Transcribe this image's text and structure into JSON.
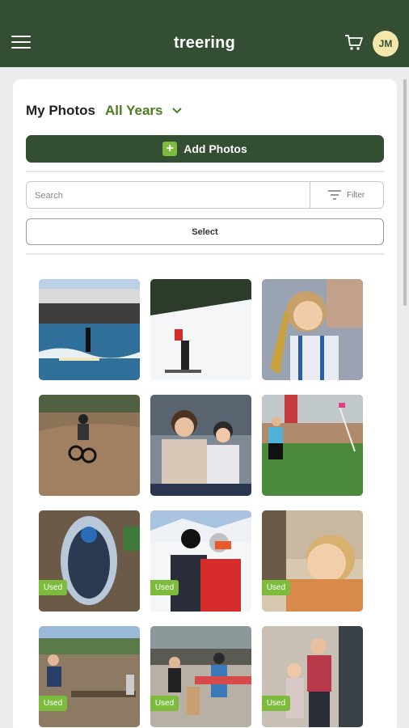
{
  "app": {
    "brand": "treering",
    "avatar_initials": "JM"
  },
  "header": {
    "title": "My Photos",
    "year_filter": "All Years"
  },
  "actions": {
    "add_photos_label": "Add Photos",
    "select_label": "Select"
  },
  "search": {
    "placeholder": "Search",
    "filter_label": "Filter"
  },
  "badge": {
    "used_label": "Used"
  },
  "colors": {
    "appbar": "#344e33",
    "accent_green": "#7dbb3d",
    "year_text": "#4c7d22"
  },
  "icons": [
    "hamburger-menu-icon",
    "cart-icon",
    "chevron-down-icon",
    "plus-icon",
    "filter-icon"
  ],
  "photos": [
    {
      "subject": "surfer at pier",
      "used": false
    },
    {
      "subject": "snowboarder on slope",
      "used": false
    },
    {
      "subject": "boy playing saxophone",
      "used": false
    },
    {
      "subject": "bike rider on dirt track",
      "used": false
    },
    {
      "subject": "two girls on bench",
      "used": false
    },
    {
      "subject": "soccer player on field",
      "used": false
    },
    {
      "subject": "child in sled",
      "used": true
    },
    {
      "subject": "skiers selfie",
      "used": true
    },
    {
      "subject": "girl resting head",
      "used": true
    },
    {
      "subject": "boy on beach with driftwood",
      "used": true
    },
    {
      "subject": "kids on beach with boogie board",
      "used": true
    },
    {
      "subject": "two kids posing indoors",
      "used": true
    }
  ]
}
